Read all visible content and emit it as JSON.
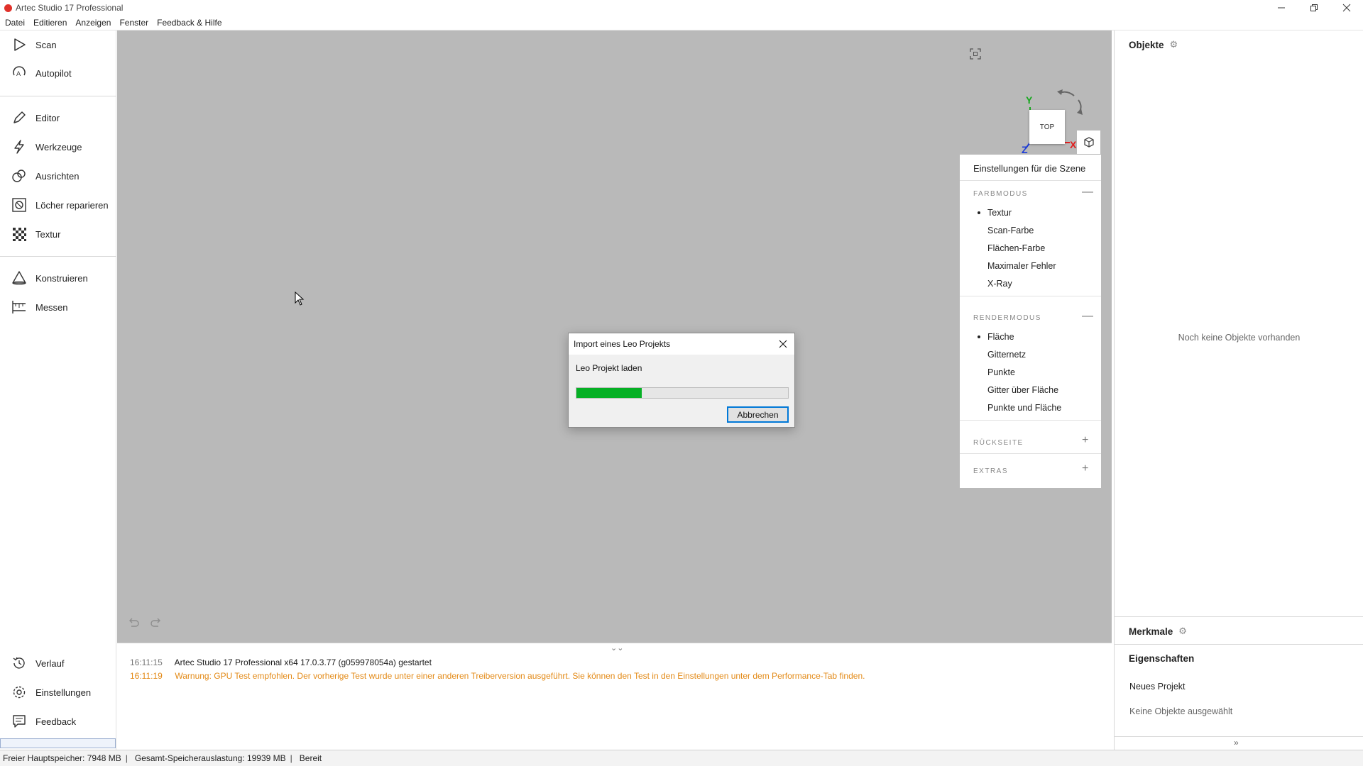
{
  "window": {
    "title": "Artec Studio 17 Professional",
    "controls": [
      "minimize-icon",
      "restore-icon",
      "close-icon"
    ]
  },
  "menu": {
    "items": [
      "Datei",
      "Editieren",
      "Anzeigen",
      "Fenster",
      "Feedback & Hilfe"
    ]
  },
  "sidebar": {
    "items": [
      {
        "label": "Scan",
        "icon": "play-icon"
      },
      {
        "label": "Autopilot",
        "icon": "autopilot-icon"
      },
      {
        "label": "Editor",
        "icon": "pencil-icon"
      },
      {
        "label": "Werkzeuge",
        "icon": "lightning-icon"
      },
      {
        "label": "Ausrichten",
        "icon": "align-icon"
      },
      {
        "label": "Löcher reparieren",
        "icon": "hole-fill-icon"
      },
      {
        "label": "Textur",
        "icon": "texture-icon"
      },
      {
        "label": "Konstruieren",
        "icon": "construct-icon"
      },
      {
        "label": "Messen",
        "icon": "measure-icon"
      }
    ],
    "bottom_items": [
      {
        "label": "Verlauf",
        "icon": "history-icon"
      },
      {
        "label": "Einstellungen",
        "icon": "gear-icon"
      },
      {
        "label": "Feedback",
        "icon": "feedback-icon"
      }
    ]
  },
  "viewport": {
    "background": "#b9b9b9",
    "gizmo": {
      "face": "TOP",
      "x": "X",
      "y": "Y",
      "z": "Z"
    }
  },
  "scene_panel": {
    "title": "Einstellungen für die Szene",
    "color_mode": {
      "title": "FARBMODUS",
      "toggle": "—",
      "options": [
        "Textur",
        "Scan-Farbe",
        "Flächen-Farbe",
        "Maximaler Fehler",
        "X-Ray"
      ],
      "selected": "Textur"
    },
    "render_mode": {
      "title": "RENDERMODUS",
      "toggle": "—",
      "options": [
        "Fläche",
        "Gitternetz",
        "Punkte",
        "Gitter über Fläche",
        "Punkte und Fläche"
      ],
      "selected": "Fläche"
    },
    "backside": {
      "title": "RÜCKSEITE",
      "toggle": "+"
    },
    "extras": {
      "title": "EXTRAS",
      "toggle": "+"
    }
  },
  "dialog": {
    "title": "Import eines Leo Projekts",
    "message": "Leo Projekt laden",
    "progress": 0.31,
    "cancel_label": "Abbrechen"
  },
  "log": {
    "toggle": "⌄⌄",
    "entries": [
      {
        "time": "16:11:15",
        "message": "Artec Studio 17 Professional x64 17.0.3.77 (g059978054a) gestartet",
        "level": "info"
      },
      {
        "time": "16:11:19",
        "message": "Warnung: GPU Test empfohlen. Der vorherige Test wurde unter einer anderen Treiberversion ausgeführt. Sie können den Test in den Einstellungen unter dem Performance-Tab finden.",
        "level": "warning"
      }
    ]
  },
  "right_panel": {
    "objects_title": "Objekte",
    "objects_empty": "Noch keine Objekte vorhanden",
    "features_title": "Merkmale",
    "properties_title": "Eigenschaften",
    "project_name": "Neues Projekt",
    "selection_text": "Keine Objekte ausgewählt",
    "expand": "»"
  },
  "status": {
    "free_memory": "Freier Hauptspeicher: 7948 MB",
    "total_memory": "Gesamt-Speicherauslastung: 19939 MB",
    "state": "Bereit",
    "separator": "|"
  },
  "colors": {
    "progress": "#06b025",
    "warning": "#e38a17",
    "axis_x": "#e02020",
    "axis_y": "#18a81f",
    "axis_z": "#1c3bd6"
  }
}
